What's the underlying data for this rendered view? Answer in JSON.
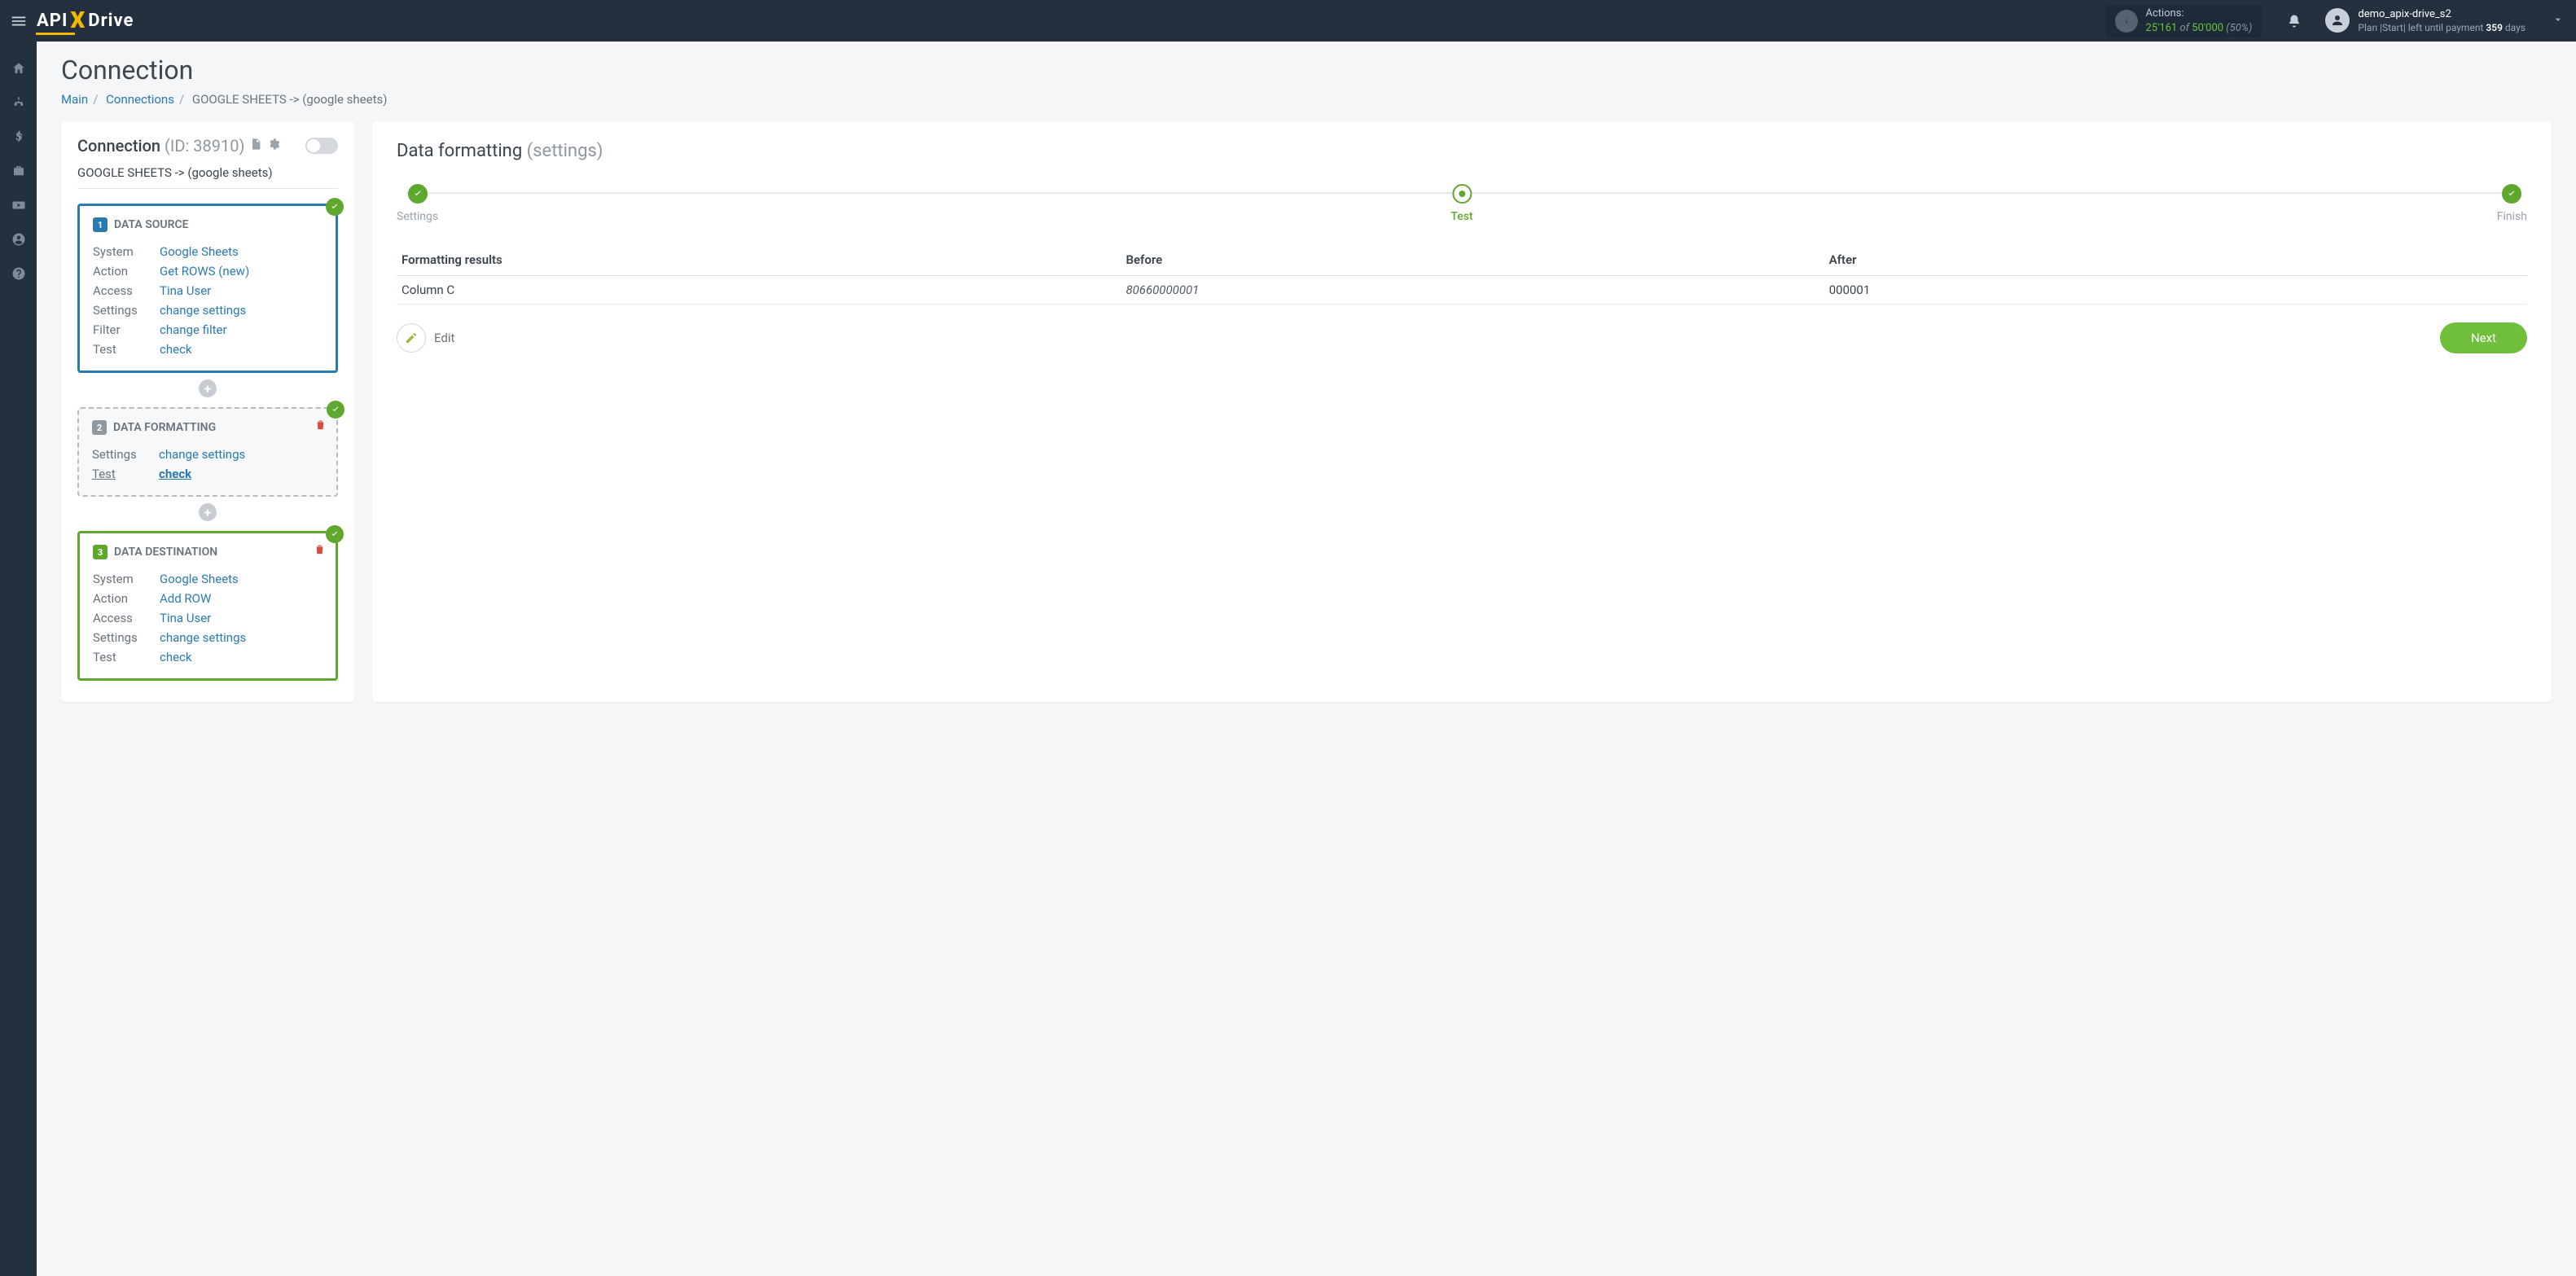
{
  "topbar": {
    "actions_label": "Actions:",
    "actions_used": "25'161",
    "actions_of": " of ",
    "actions_total": "50'000",
    "actions_pct": " (50%)",
    "user_name": "demo_apix-drive_s2",
    "plan_prefix": "Plan |Start| left until payment ",
    "plan_days": "359",
    "plan_suffix": " days"
  },
  "page": {
    "title": "Connection",
    "breadcrumb": {
      "main": "Main",
      "connections": "Connections",
      "current": "GOOGLE SHEETS -> (google sheets)"
    }
  },
  "left": {
    "head": "Connection ",
    "id": "(ID: 38910)",
    "sub": "GOOGLE SHEETS -> (google sheets)",
    "src": {
      "title": "DATA SOURCE",
      "system_k": "System",
      "system_v": "Google Sheets",
      "action_k": "Action",
      "action_v": "Get ROWS (new)",
      "access_k": "Access",
      "access_v": "Tina User",
      "settings_k": "Settings",
      "settings_v": "change settings",
      "filter_k": "Filter",
      "filter_v": "change filter",
      "test_k": "Test",
      "test_v": "check"
    },
    "fmt": {
      "title": "DATA FORMATTING",
      "settings_k": "Settings",
      "settings_v": "change settings",
      "test_k": "Test",
      "test_v": "check"
    },
    "dst": {
      "title": "DATA DESTINATION",
      "system_k": "System",
      "system_v": "Google Sheets",
      "action_k": "Action",
      "action_v": "Add ROW",
      "access_k": "Access",
      "access_v": "Tina User",
      "settings_k": "Settings",
      "settings_v": "change settings",
      "test_k": "Test",
      "test_v": "check"
    }
  },
  "right": {
    "title": "Data formatting ",
    "subtitle": "(settings)",
    "step1": "Settings",
    "step2": "Test",
    "step3": "Finish",
    "th1": "Formatting results",
    "th2": "Before",
    "th3": "After",
    "row_col": "Column C",
    "row_before": "80660000001",
    "row_after": "000001",
    "edit": "Edit",
    "next": "Next"
  }
}
